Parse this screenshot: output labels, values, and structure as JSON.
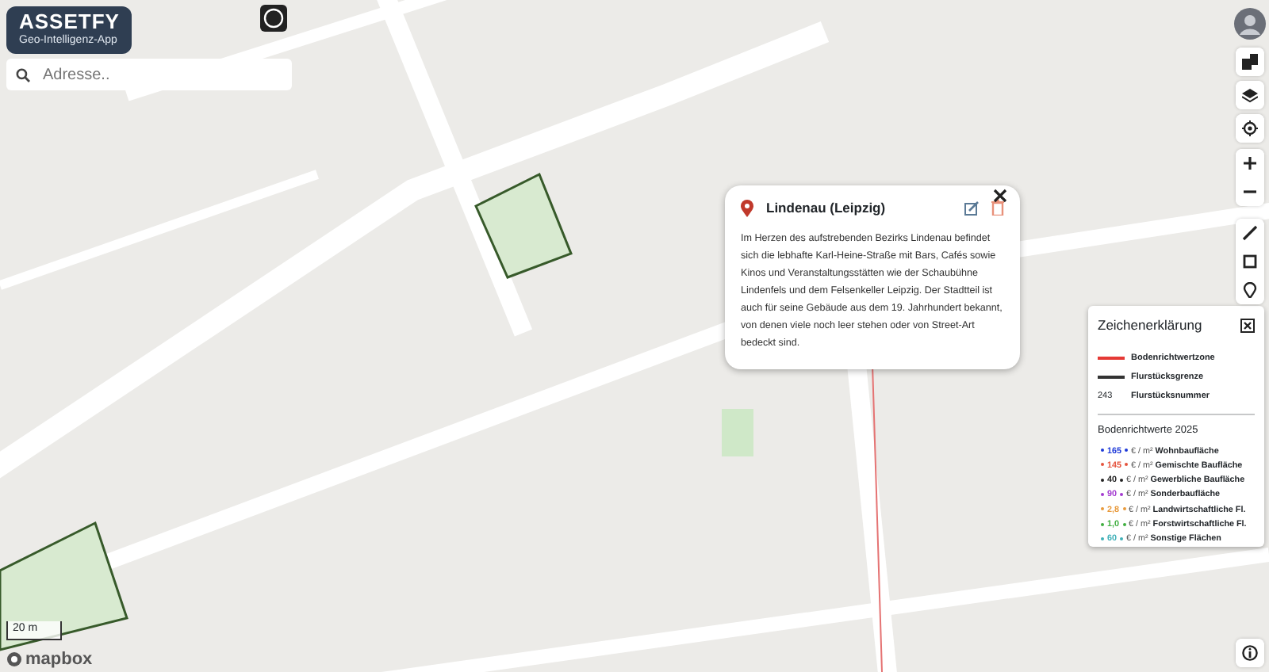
{
  "brand": {
    "title": "ASSETFY",
    "subtitle": "Geo-Intelligenz-App"
  },
  "search": {
    "placeholder": "Adresse.."
  },
  "popup": {
    "title": "Lindenau (Leipzig)",
    "text": "Im Herzen des aufstrebenden Bezirks Lindenau befindet sich die lebhafte Karl-Heine-Straße mit Bars, Cafés sowie Kinos und Veranstaltungsstätten wie der Schaubühne Lindenfels und dem Felsenkeller Leipzig. Der Stadtteil ist auch für seine Gebäude aus dem 19. Jahrhundert bekannt, von denen viele noch leer stehen oder von Street-Art bedeckt sind."
  },
  "legend": {
    "title": "Zeichenerklärung",
    "lines": [
      {
        "kind": "line",
        "color": "#e53935",
        "label": "Bodenrichtwertzone"
      },
      {
        "kind": "line",
        "color": "#333333",
        "label": "Flurstücksgrenze"
      },
      {
        "kind": "number",
        "symbol": "243",
        "label": "Flurstücksnummer"
      }
    ],
    "values_title": "Bodenrichtwerte 2025",
    "values": [
      {
        "value": "165",
        "color": "#1e3ad8",
        "unit": "€ / m²",
        "label": "Wohnbaufläche"
      },
      {
        "value": "145",
        "color": "#e5533d",
        "unit": "€ / m²",
        "label": "Gemischte Baufläche"
      },
      {
        "value": "40",
        "color": "#222222",
        "unit": "€ / m²",
        "label": "Gewerbliche Baufläche"
      },
      {
        "value": "90",
        "color": "#a33ad0",
        "unit": "€ / m²",
        "label": "Sonderbaufläche"
      },
      {
        "value": "2,8",
        "color": "#e89a3c",
        "unit": "€ / m²",
        "label": "Landwirtschaftliche Fl."
      },
      {
        "value": "1,0",
        "color": "#3fae3f",
        "unit": "€ / m²",
        "label": "Forstwirtschaftliche Fl."
      },
      {
        "value": "60",
        "color": "#3fb0b8",
        "unit": "€ / m²",
        "label": "Sonstige Flächen"
      }
    ]
  },
  "scale": {
    "label": "20 m"
  },
  "attribution": {
    "logo": "mapbox"
  }
}
